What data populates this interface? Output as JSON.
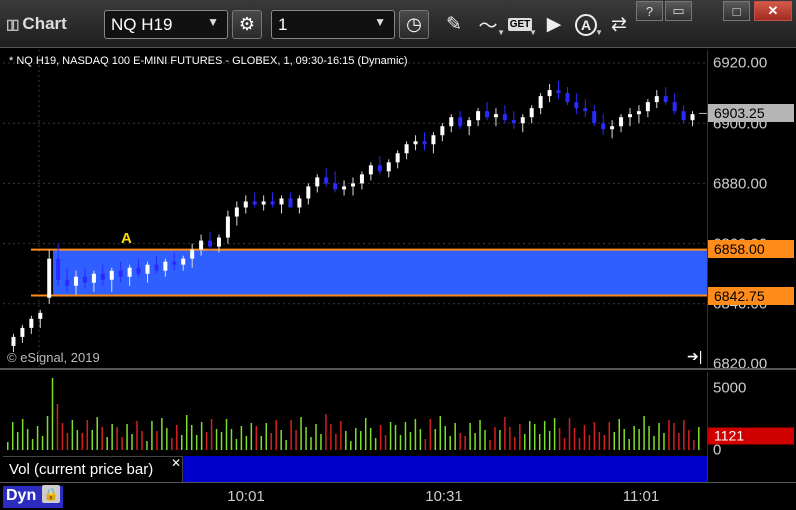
{
  "app": {
    "title": "Chart",
    "symbol": "NQ H19",
    "interval": "1"
  },
  "toolbar": {
    "icons": [
      "settings-gear-icon",
      "clock-icon",
      "pencil-draw-icon",
      "study-icon",
      "get-data-icon",
      "play-icon",
      "alert-a-icon",
      "link-icon"
    ],
    "get_label": "GET",
    "alert_letter": "A"
  },
  "window_controls": {
    "help": "?",
    "restore": "▭",
    "maximize": "□",
    "close": "✕"
  },
  "chart": {
    "header": "* NQ H19, NASDAQ 100 E-MINI FUTURES - GLOBEX, 1, 09:30-16:15 (Dynamic)",
    "copyright": "© eSignal, 2019",
    "scroll_end_icon": "➔|",
    "alert_marker": "A",
    "colors": {
      "up": "#ffffff",
      "down": "#2a2aff",
      "zone_fill": "#2f5fff",
      "zone_line": "#ff8c1a",
      "grid": "#3a3a3a"
    }
  },
  "price_axis": {
    "labels": [
      "6920.00",
      "6900.00",
      "6880.00",
      "6860.00",
      "6840.00",
      "6820.00"
    ],
    "last_price": "6903.25",
    "zone_upper": "6858.00",
    "zone_lower": "6842.75"
  },
  "volume": {
    "legend": "Vol (current price bar)",
    "close_icon": "✕",
    "axis_labels": [
      "5000",
      "0"
    ],
    "current": "1121",
    "colors": {
      "up": "#7ddf2c",
      "down": "#d42020"
    }
  },
  "time_axis": {
    "mode": "Dyn",
    "lock_icon": "lock-icon",
    "labels": [
      "10:01",
      "10:31",
      "11:01"
    ]
  },
  "chart_data": {
    "type": "candlestick",
    "symbol": "NQ H19",
    "ylim": [
      6816,
      6925
    ],
    "zone": {
      "upper": 6858.0,
      "lower": 6842.75
    },
    "last": 6903.25,
    "x_labels": [
      "10:01",
      "10:31",
      "11:01"
    ],
    "bars": [
      [
        6826,
        6830,
        6824,
        6829
      ],
      [
        6829,
        6833,
        6827,
        6832
      ],
      [
        6832,
        6836,
        6830,
        6835
      ],
      [
        6835,
        6838,
        6832,
        6837
      ],
      [
        6842,
        6858,
        6840,
        6855
      ],
      [
        6855,
        6860,
        6846,
        6848
      ],
      [
        6848,
        6852,
        6844,
        6846
      ],
      [
        6846,
        6851,
        6843,
        6849
      ],
      [
        6849,
        6852,
        6845,
        6847
      ],
      [
        6847,
        6851,
        6844,
        6850
      ],
      [
        6850,
        6853,
        6846,
        6848
      ],
      [
        6848,
        6852,
        6844,
        6851
      ],
      [
        6851,
        6854,
        6847,
        6849
      ],
      [
        6849,
        6853,
        6846,
        6852
      ],
      [
        6852,
        6855,
        6849,
        6850
      ],
      [
        6850,
        6854,
        6847,
        6853
      ],
      [
        6853,
        6856,
        6850,
        6851
      ],
      [
        6851,
        6855,
        6849,
        6854
      ],
      [
        6854,
        6857,
        6851,
        6853
      ],
      [
        6853,
        6856,
        6851,
        6855
      ],
      [
        6855,
        6860,
        6852,
        6858
      ],
      [
        6858,
        6863,
        6856,
        6861
      ],
      [
        6861,
        6864,
        6858,
        6859
      ],
      [
        6859,
        6863,
        6857,
        6862
      ],
      [
        6862,
        6871,
        6860,
        6869
      ],
      [
        6869,
        6874,
        6866,
        6872
      ],
      [
        6872,
        6876,
        6870,
        6874
      ],
      [
        6874,
        6877,
        6872,
        6873
      ],
      [
        6873,
        6876,
        6871,
        6874
      ],
      [
        6874,
        6877,
        6872,
        6873
      ],
      [
        6873,
        6876,
        6870,
        6875
      ],
      [
        6875,
        6877,
        6872,
        6872
      ],
      [
        6872,
        6876,
        6870,
        6875
      ],
      [
        6875,
        6880,
        6873,
        6879
      ],
      [
        6879,
        6883,
        6877,
        6882
      ],
      [
        6882,
        6885,
        6879,
        6880
      ],
      [
        6880,
        6884,
        6877,
        6878
      ],
      [
        6878,
        6881,
        6876,
        6879
      ],
      [
        6879,
        6882,
        6876,
        6880
      ],
      [
        6880,
        6884,
        6878,
        6883
      ],
      [
        6883,
        6887,
        6881,
        6886
      ],
      [
        6886,
        6889,
        6883,
        6884
      ],
      [
        6884,
        6888,
        6882,
        6887
      ],
      [
        6887,
        6891,
        6885,
        6890
      ],
      [
        6890,
        6894,
        6888,
        6893
      ],
      [
        6893,
        6896,
        6891,
        6894
      ],
      [
        6894,
        6897,
        6891,
        6893
      ],
      [
        6893,
        6897,
        6890,
        6896
      ],
      [
        6896,
        6900,
        6894,
        6899
      ],
      [
        6899,
        6903,
        6897,
        6902
      ],
      [
        6902,
        6904,
        6898,
        6899
      ],
      [
        6899,
        6902,
        6896,
        6901
      ],
      [
        6901,
        6905,
        6899,
        6904
      ],
      [
        6904,
        6907,
        6901,
        6902
      ],
      [
        6902,
        6905,
        6899,
        6903
      ],
      [
        6903,
        6906,
        6900,
        6901
      ],
      [
        6901,
        6904,
        6898,
        6900
      ],
      [
        6900,
        6903,
        6897,
        6902
      ],
      [
        6902,
        6906,
        6900,
        6905
      ],
      [
        6905,
        6910,
        6903,
        6909
      ],
      [
        6909,
        6913,
        6907,
        6911
      ],
      [
        6911,
        6914,
        6908,
        6910
      ],
      [
        6910,
        6912,
        6906,
        6907
      ],
      [
        6907,
        6910,
        6903,
        6905
      ],
      [
        6905,
        6908,
        6902,
        6904
      ],
      [
        6904,
        6906,
        6899,
        6900
      ],
      [
        6900,
        6903,
        6896,
        6898
      ],
      [
        6898,
        6901,
        6895,
        6899
      ],
      [
        6899,
        6903,
        6897,
        6902
      ],
      [
        6902,
        6905,
        6899,
        6903
      ],
      [
        6903,
        6906,
        6900,
        6904
      ],
      [
        6904,
        6908,
        6902,
        6907
      ],
      [
        6907,
        6911,
        6905,
        6909
      ],
      [
        6909,
        6912,
        6906,
        6907
      ],
      [
        6907,
        6910,
        6903,
        6904
      ],
      [
        6904,
        6906,
        6900,
        6901
      ],
      [
        6901,
        6904,
        6899,
        6903
      ]
    ],
    "volume_max": 5000
  }
}
